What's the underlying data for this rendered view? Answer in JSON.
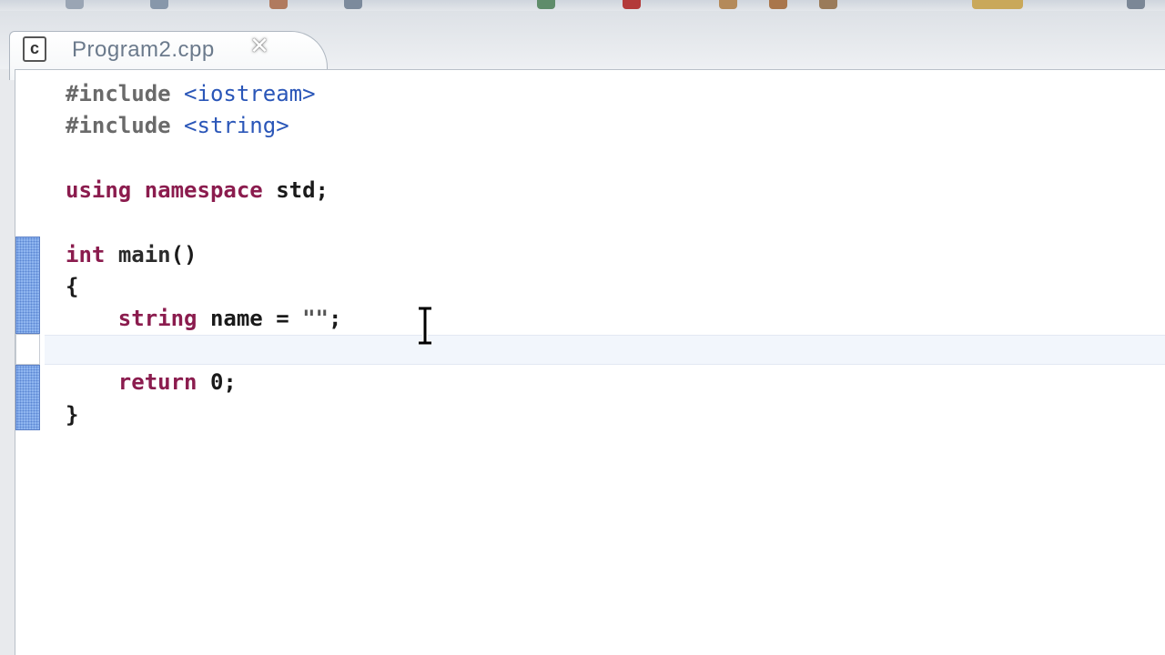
{
  "tab": {
    "icon": "cpp-file-icon",
    "icon_letter": "c",
    "title": "Program2.cpp",
    "close_label": "✕"
  },
  "code": {
    "lines": [
      {
        "pp": "#include ",
        "inc": "<iostream>"
      },
      {
        "pp": "#include ",
        "inc": "<string>"
      },
      {
        "text": ""
      },
      {
        "kw1": "using",
        "kw2": "namespace",
        "plain": " std;"
      },
      {
        "text": ""
      },
      {
        "kw": "int",
        "fn": "main",
        "plain": "()"
      },
      {
        "plain": "{"
      },
      {
        "indent": "    ",
        "kw": "string",
        "plain": " name = ",
        "str": "\"\"",
        "tail": ";"
      },
      {
        "text": ""
      },
      {
        "indent": "    ",
        "kw": "return",
        "plain": " 0;"
      },
      {
        "plain": "}"
      }
    ]
  },
  "colors": {
    "keyword": "#8b1c4e",
    "include_path": "#2a56b8",
    "change_marker": "#8fb5ef"
  },
  "cursor": {
    "icon": "text-cursor-icon"
  }
}
